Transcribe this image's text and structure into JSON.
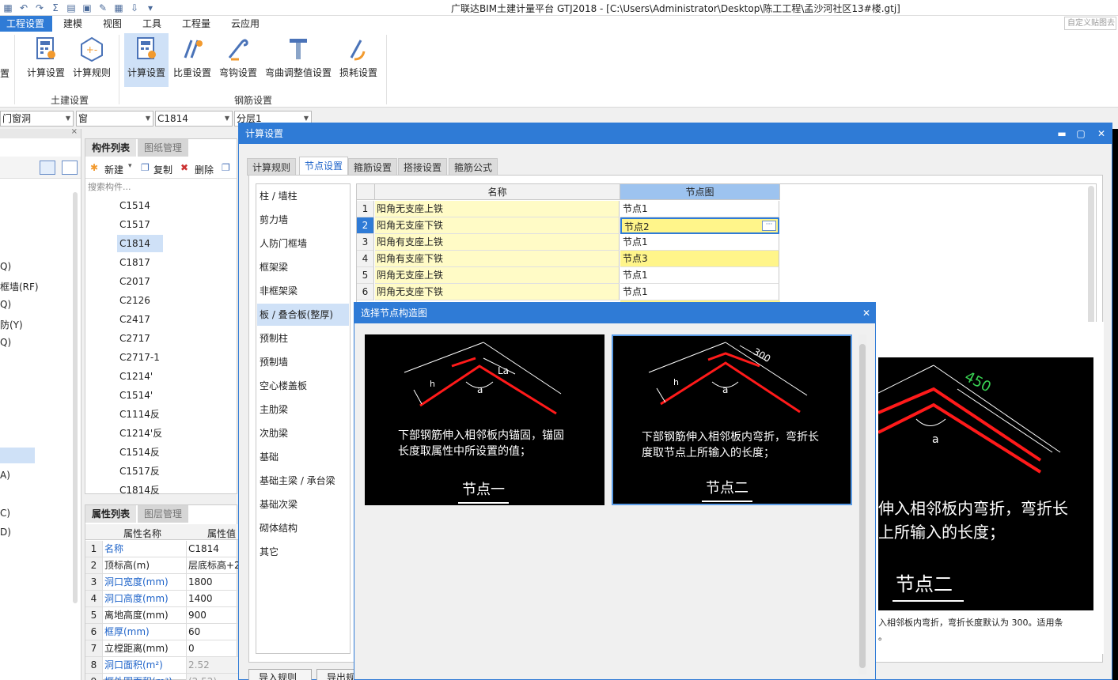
{
  "app": {
    "title": "广联达BIM土建计量平台 GTJ2018 - [C:\\Users\\Administrator\\Desktop\\陈工工程\\孟沙河社区13#楼.gtj]"
  },
  "menu": {
    "items": [
      "工程设置",
      "建模",
      "视图",
      "工具",
      "工程量",
      "云应用"
    ],
    "search_placeholder": "自定义贴图去"
  },
  "ribbon": {
    "partial_label": "置",
    "buttons": {
      "calc_settings_civil": "计算设置",
      "calc_rules": "计算规则",
      "calc_settings_rebar": "计算设置",
      "weight_settings": "比重设置",
      "hook_settings": "弯钩设置",
      "bend_adjust": "弯曲调整值设置",
      "loss_settings": "损耗设置"
    },
    "groups": {
      "civil": "土建设置",
      "rebar": "钢筋设置"
    }
  },
  "combos": [
    "门窗洞",
    "窗",
    "C1814",
    "分层1"
  ],
  "left_panel": {
    "items": [
      "Q)",
      "框墙(RF)",
      "Q)",
      "防(Y)",
      "Q)",
      "A)",
      "C)",
      "D)"
    ]
  },
  "component_list": {
    "tabs": [
      "构件列表",
      "图纸管理"
    ],
    "toolbar": {
      "new": "新建",
      "copy": "复制",
      "delete": "删除"
    },
    "search_placeholder": "搜索构件...",
    "items": [
      "C1514",
      "C1517",
      "C1814",
      "C1817",
      "C2017",
      "C2126",
      "C2417",
      "C2717",
      "C2717-1",
      "C1214'",
      "C1514'",
      "C1114反",
      "C1214'反",
      "C1514反",
      "C1517反",
      "C1814反"
    ],
    "selected": "C1814"
  },
  "properties": {
    "tabs": [
      "属性列表",
      "图层管理"
    ],
    "headers": [
      "属性名称",
      "属性值"
    ],
    "rows": [
      {
        "no": "1",
        "name": "名称",
        "value": "C1814",
        "blue": true
      },
      {
        "no": "2",
        "name": "顶标高(m)",
        "value": "层底标高+2.",
        "blue": false
      },
      {
        "no": "3",
        "name": "洞口宽度(mm)",
        "value": "1800",
        "blue": true
      },
      {
        "no": "4",
        "name": "洞口高度(mm)",
        "value": "1400",
        "blue": true
      },
      {
        "no": "5",
        "name": "离地高度(mm)",
        "value": "900",
        "blue": false
      },
      {
        "no": "6",
        "name": "框厚(mm)",
        "value": "60",
        "blue": true
      },
      {
        "no": "7",
        "name": "立樘距离(mm)",
        "value": "0",
        "blue": false
      },
      {
        "no": "8",
        "name": "洞口面积(m²)",
        "value": "2.52",
        "blue": true
      },
      {
        "no": "9",
        "name": "框外围面积(m²)",
        "value": "(2.52)",
        "blue": true
      }
    ]
  },
  "dialog": {
    "title": "计算设置",
    "tabs": [
      "计算规则",
      "节点设置",
      "箍筋设置",
      "搭接设置",
      "箍筋公式"
    ],
    "active_tab": "节点设置",
    "categories": [
      "柱 / 墙柱",
      "剪力墙",
      "人防门框墙",
      "框架梁",
      "非框架梁",
      "板 / 叠合板(整厚)",
      "预制柱",
      "预制墙",
      "空心楼盖板",
      "主肋梁",
      "次肋梁",
      "基础",
      "基础主梁 / 承台梁",
      "基础次梁",
      "砌体结构",
      "其它"
    ],
    "selected_category": "板 / 叠合板(整厚)",
    "grid_headers": [
      "名称",
      "节点图"
    ],
    "grid_rows": [
      {
        "no": "1",
        "name": "阳角无支座上铁",
        "node": "节点1",
        "style": "plain"
      },
      {
        "no": "2",
        "name": "阳角无支座下铁",
        "node": "节点2",
        "style": "edit"
      },
      {
        "no": "3",
        "name": "阳角有支座上铁",
        "node": "节点1",
        "style": "plain"
      },
      {
        "no": "4",
        "name": "阳角有支座下铁",
        "node": "节点3",
        "style": "yellow"
      },
      {
        "no": "5",
        "name": "阴角无支座上铁",
        "node": "节点1",
        "style": "plain"
      },
      {
        "no": "6",
        "name": "阴角无支座下铁",
        "node": "节点1",
        "style": "plain"
      }
    ],
    "preview": {
      "dim": "450",
      "angle": "a",
      "caption_lines": [
        "伸入相邻板内弯折，弯折长",
        "上所输入的长度；"
      ],
      "node_name": "节点二",
      "description_lines": [
        "入相邻板内弯折，弯折长度默认为 300。适用条",
        "。"
      ]
    },
    "buttons": [
      "导入规则",
      "导出规"
    ]
  },
  "sub_dialog": {
    "title": "选择节点构造图",
    "nodes": [
      {
        "label_top": "La",
        "angle": "a",
        "h": "h",
        "caption": [
          "下部钢筋伸入相邻板内锚固，锚固",
          "长度取属性中所设置的值；"
        ],
        "name": "节点一"
      },
      {
        "label_top": "300",
        "angle": "a",
        "h": "h",
        "caption": [
          "下部钢筋伸入相邻板内弯折，弯折长",
          "度取节点上所输入的长度；"
        ],
        "name": "节点二"
      }
    ]
  },
  "colors": {
    "accent": "#2f7bd6",
    "selection": "#cfe1f7",
    "rebar_red": "#ff1a1a",
    "dim_green": "#39d353",
    "grid_yellow": "#fffbc6"
  }
}
